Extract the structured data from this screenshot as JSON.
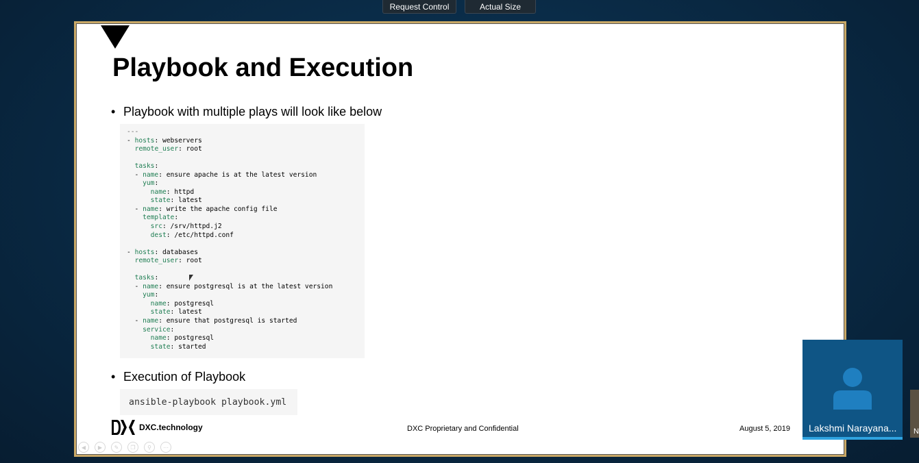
{
  "toolbar": {
    "request_control_label": "Request Control",
    "actual_size_label": "Actual Size"
  },
  "slide": {
    "title": "Playbook and Execution",
    "bullet1": "Playbook with multiple plays will look like below",
    "bullet_symbol": "•",
    "code_lines": [
      "---",
      "- hosts: webservers",
      "  remote_user: root",
      "",
      "  tasks:",
      "  - name: ensure apache is at the latest version",
      "    yum:",
      "      name: httpd",
      "      state: latest",
      "  - name: write the apache config file",
      "    template:",
      "      src: /srv/httpd.j2",
      "      dest: /etc/httpd.conf",
      "",
      "- hosts: databases",
      "  remote_user: root",
      "",
      "  tasks:",
      "  - name: ensure postgresql is at the latest version",
      "    yum:",
      "      name: postgresql",
      "      state: latest",
      "  - name: ensure that postgresql is started",
      "    service:",
      "      name: postgresql",
      "      state: started"
    ],
    "bullet2": "Execution of Playbook",
    "command": "ansible-playbook playbook.yml",
    "footer": {
      "logo_text": "DXC.technology",
      "center_text": "DXC Proprietary and Confidential",
      "date": "August 5, 2019"
    },
    "controls": [
      "prev-icon",
      "next-icon",
      "pen-icon",
      "copy-icon",
      "zoom-icon",
      "more-icon"
    ]
  },
  "participant": {
    "name": "Lakshmi Narayana...",
    "peek_label": "N"
  },
  "colors": {
    "code_key": "#1e7d52",
    "tile_bg": "#0f5585",
    "tile_accent": "#2fa3e0",
    "frame": "#c9a866"
  }
}
